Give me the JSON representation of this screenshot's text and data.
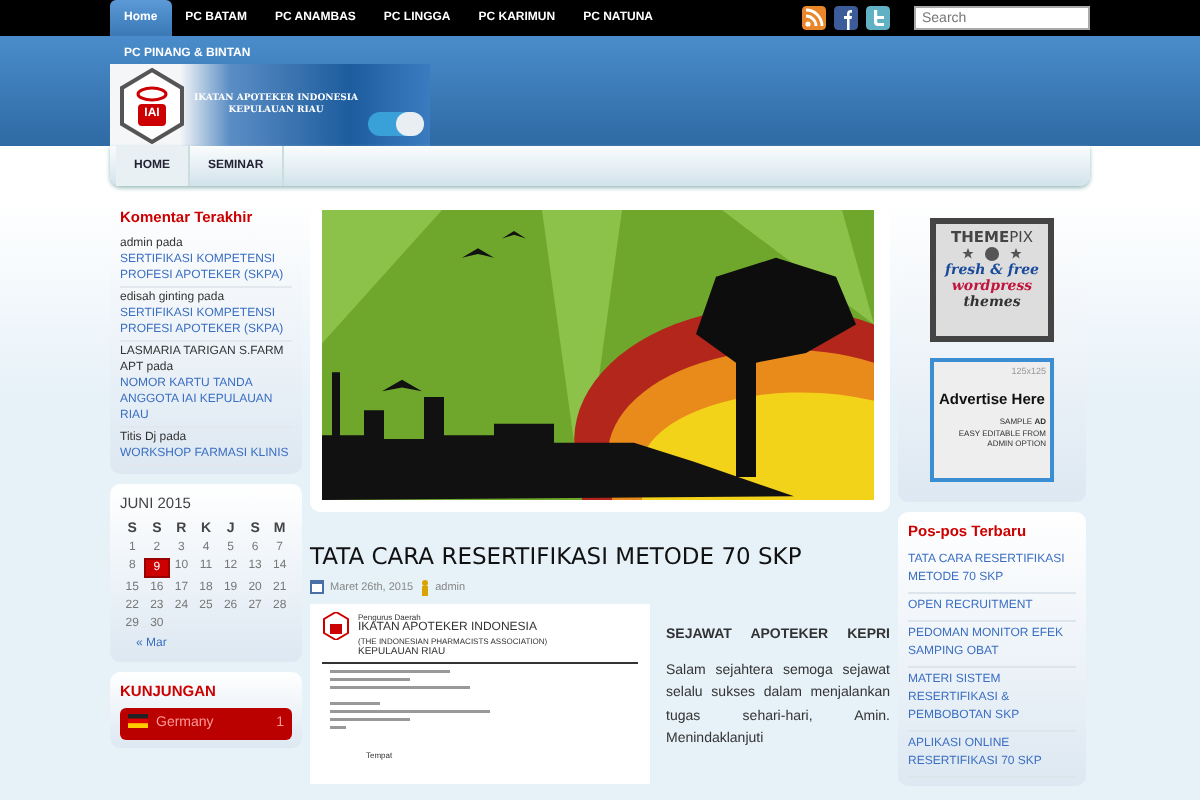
{
  "top_nav": {
    "items": [
      {
        "label": "Home",
        "selected": true
      },
      {
        "label": "PC BATAM",
        "selected": false
      },
      {
        "label": "PC ANAMBAS",
        "selected": false
      },
      {
        "label": "PC LINGGA",
        "selected": false
      },
      {
        "label": "PC KARIMUN",
        "selected": false
      },
      {
        "label": "PC NATUNA",
        "selected": false
      },
      {
        "label": "PC PINANG & BINTAN",
        "selected": false
      }
    ],
    "search": {
      "placeholder": "Search"
    }
  },
  "banner": {
    "logo_text": "IAI",
    "lines": [
      "IKATAN APOTEKER INDONESIA",
      "KEPULAUAN RIAU"
    ]
  },
  "sub_nav": [
    {
      "label": "HOME",
      "selected": true
    },
    {
      "label": "SEMINAR",
      "selected": false
    }
  ],
  "recent_comments": {
    "title": "Komentar Terakhir",
    "items": [
      {
        "author": "admin",
        "word": "pada",
        "post": "SERTIFIKASI KOMPETENSI PROFESI APOTEKER (SKPA)"
      },
      {
        "author": "edisah ginting",
        "word": "pada",
        "post": "SERTIFIKASI KOMPETENSI PROFESI APOTEKER (SKPA)"
      },
      {
        "author": "LASMARIA TARIGAN S.FARM APT",
        "word": "pada",
        "post": "NOMOR KARTU TANDA ANGGOTA IAI KEPULAUAN RIAU"
      },
      {
        "author": "Titis Dj",
        "word": "pada",
        "post": "WORKSHOP FARMASI KLINIS"
      }
    ]
  },
  "calendar": {
    "title": "JUNI 2015",
    "weekdays": [
      "S",
      "S",
      "R",
      "K",
      "J",
      "S",
      "M"
    ],
    "days": [
      {
        "day": "1",
        "today": false
      },
      {
        "day": "2",
        "today": false
      },
      {
        "day": "3",
        "today": false
      },
      {
        "day": "4",
        "today": false
      },
      {
        "day": "5",
        "today": false
      },
      {
        "day": "6",
        "today": false
      },
      {
        "day": "7",
        "today": false
      },
      {
        "day": "8",
        "today": false
      },
      {
        "day": "9",
        "today": true
      },
      {
        "day": "10",
        "today": false
      },
      {
        "day": "11",
        "today": false
      },
      {
        "day": "12",
        "today": false
      },
      {
        "day": "13",
        "today": false
      },
      {
        "day": "14",
        "today": false
      },
      {
        "day": "15",
        "today": false
      },
      {
        "day": "16",
        "today": false
      },
      {
        "day": "17",
        "today": false
      },
      {
        "day": "18",
        "today": false
      },
      {
        "day": "19",
        "today": false
      },
      {
        "day": "20",
        "today": false
      },
      {
        "day": "21",
        "today": false
      },
      {
        "day": "22",
        "today": false
      },
      {
        "day": "23",
        "today": false
      },
      {
        "day": "24",
        "today": false
      },
      {
        "day": "25",
        "today": false
      },
      {
        "day": "26",
        "today": false
      },
      {
        "day": "27",
        "today": false
      },
      {
        "day": "28",
        "today": false
      },
      {
        "day": "29",
        "today": false
      },
      {
        "day": "30",
        "today": false
      }
    ],
    "prev_link": "« Mar"
  },
  "visitors": {
    "title": "KUNJUNGAN",
    "countries": [
      {
        "name": "Germany",
        "count": "1"
      }
    ]
  },
  "post": {
    "title": "TATA CARA RESERTIFIKASI METODE 70 SKP",
    "date": "Maret 26th, 2015",
    "author": "admin",
    "letter": {
      "lines": [
        "Pengurus Daerah",
        "IKATAN APOTEKER INDONESIA",
        "(THE INDONESIAN PHARMACISTS ASSOCIATION)",
        "KEPULAUAN RIAU"
      ],
      "closing": "Tempat"
    },
    "heading": "SEJAWAT APOTEKER KEPRI",
    "paragraph": "Salam sejahtera semoga sejawat selalu sukses dalam menjalankan tugas sehari-hari, Amin. Menindaklanjuti"
  },
  "ads": {
    "themepix": {
      "brand": "**THEME**PIX",
      "lines": [
        "fresh & free",
        "wordpress",
        "themes"
      ]
    },
    "sample": {
      "size": "125x125",
      "headline": "Advertise Here",
      "tag": "SAMPLE **AD**",
      "note": "EASY EDITABLE FROM ADMIN OPTION"
    }
  },
  "recent_posts": {
    "title": "Pos-pos Terbaru",
    "items": [
      "TATA CARA RESERTIFIKASI METODE 70 SKP",
      "OPEN RECRUITMENT",
      "PEDOMAN MONITOR EFEK SAMPING OBAT",
      "MATERI SISTEM RESERTIFIKASI & PEMBOBOTAN SKP",
      "APLIKASI ONLINE RESERTIFIKASI 70 SKP"
    ]
  }
}
